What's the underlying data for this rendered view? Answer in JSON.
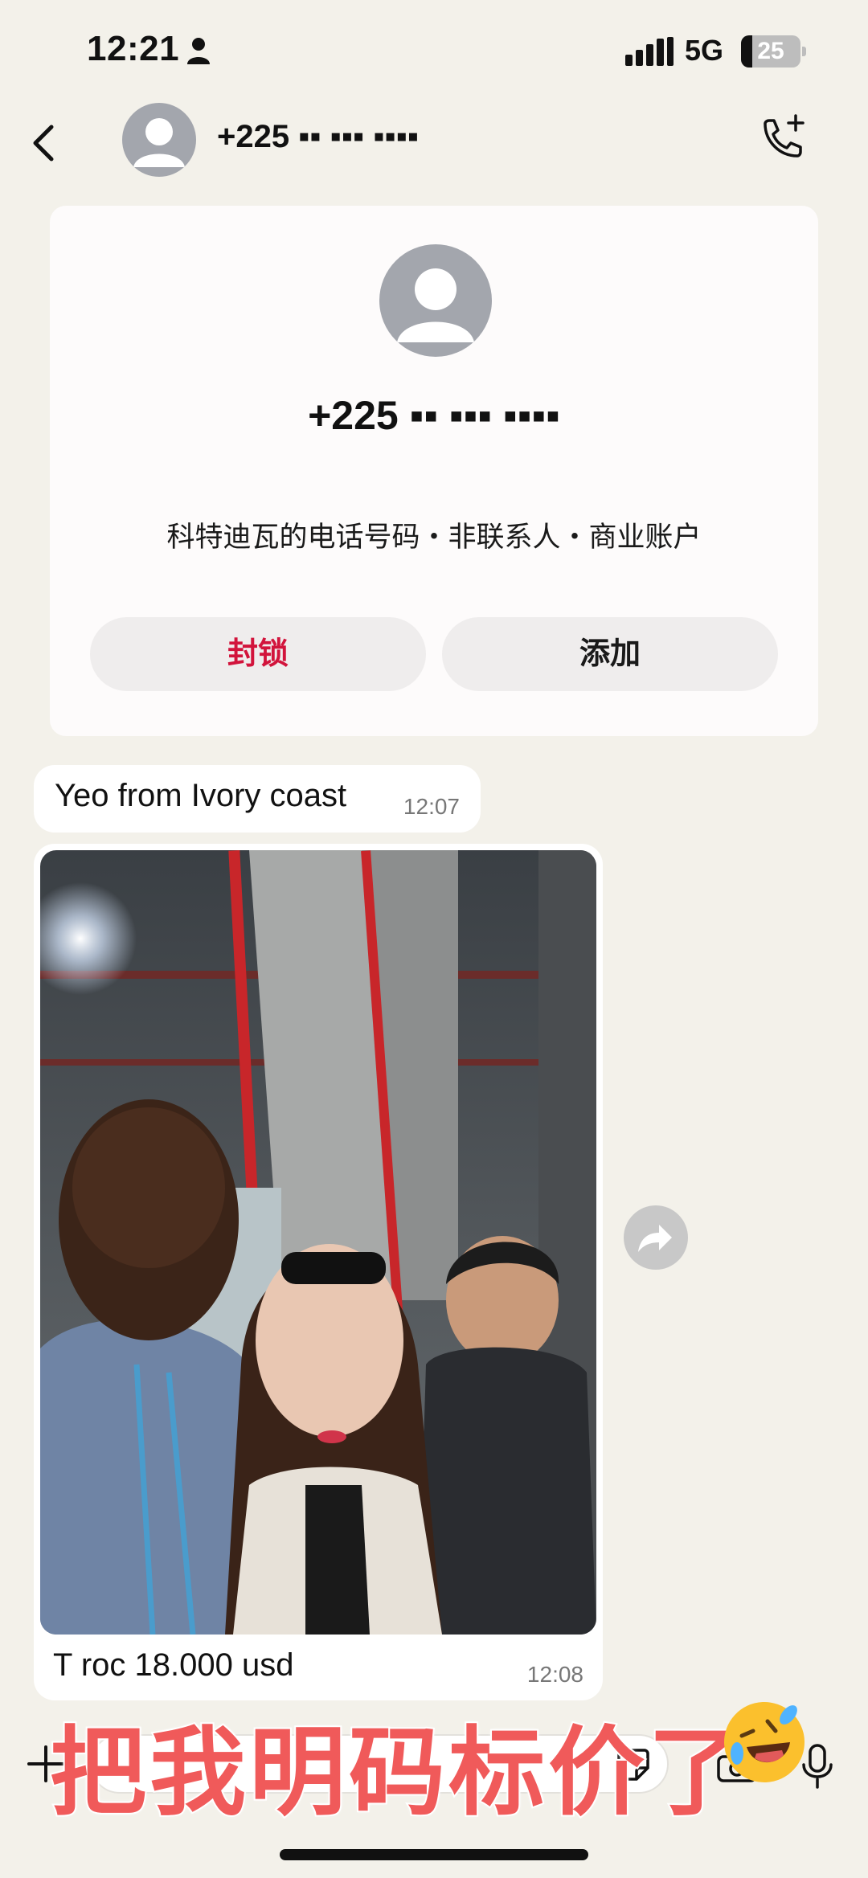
{
  "status_bar": {
    "time": "12:21",
    "network": "5G",
    "battery": "25"
  },
  "header": {
    "contact_number": "+225 ▪▪ ▪▪▪ ▪▪▪▪",
    "icons": {
      "back": "chevron-left-icon",
      "avatar": "person-avatar-icon",
      "call_add": "phone-plus-icon"
    }
  },
  "contact_card": {
    "number": "+225 ▪▪ ▪▪▪ ▪▪▪▪",
    "subline": "科特迪瓦的电话号码・非联系人・商业账户",
    "block_label": "封锁",
    "add_label": "添加",
    "colors": {
      "block": "#d2143c"
    }
  },
  "messages": [
    {
      "text": "Yeo from Ivory coast",
      "time": "12:07"
    },
    {
      "type": "photo",
      "caption": "T roc 18.000 usd",
      "time": "12:08"
    }
  ],
  "input_bar": {
    "icons": [
      "plus-icon",
      "sticker-icon",
      "camera-icon",
      "microphone-icon"
    ]
  },
  "overlay": {
    "caption": "把我明码标价了",
    "emoji": "rolling-laughing-emoji",
    "color": "#f05a5a"
  }
}
